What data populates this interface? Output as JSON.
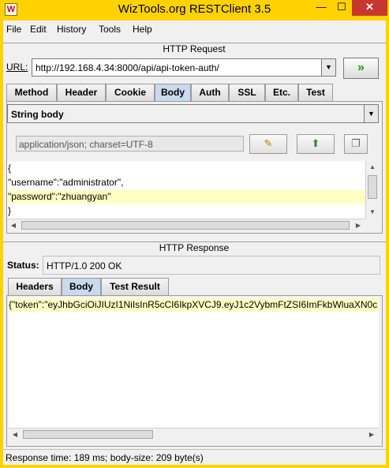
{
  "window": {
    "title": "WizTools.org RESTClient 3.5",
    "controls": {
      "minimize": "—",
      "maximize": "☐",
      "close": "✕"
    }
  },
  "menu": [
    {
      "label": "File",
      "mnemonic": "F"
    },
    {
      "label": "Edit",
      "mnemonic": "E"
    },
    {
      "label": "History",
      "mnemonic": "H"
    },
    {
      "label": "Tools",
      "mnemonic": "T"
    },
    {
      "label": "Help",
      "mnemonic": "H"
    }
  ],
  "request": {
    "section_title": "HTTP Request",
    "url_label": "URL:",
    "url_value": "http://192.168.4.34:8000/api/api-token-auth/",
    "go_label": "»",
    "tabs": [
      {
        "label": "Method",
        "active": false
      },
      {
        "label": "Header",
        "active": false
      },
      {
        "label": "Cookie",
        "active": false
      },
      {
        "label": "Body",
        "active": true
      },
      {
        "label": "Auth",
        "active": false
      },
      {
        "label": "SSL",
        "active": false
      },
      {
        "label": "Etc.",
        "active": false
      },
      {
        "label": "Test",
        "active": false
      }
    ],
    "body_type": "String body",
    "content_type": "application/json; charset=UTF-8",
    "body_lines": [
      "{",
      "\"username\":\"administrator\",",
      "\"password\":\"zhuangyan\"",
      "}"
    ],
    "highlighted_line": 2
  },
  "response": {
    "section_title": "HTTP Response",
    "status_label": "Status:",
    "status_value": "HTTP/1.0 200 OK",
    "tabs": [
      {
        "label": "Headers",
        "active": false
      },
      {
        "label": "Body",
        "active": true
      },
      {
        "label": "Test Result",
        "active": false
      }
    ],
    "body_text": "{\"token\":\"eyJhbGciOiJIUzI1NiIsInR5cCI6IkpXVCJ9.eyJ1c2VybmFtZSI6ImFkbWluaXN0c"
  },
  "footer": {
    "status_text": "Response time: 189 ms; body-size: 209 byte(s)"
  },
  "colors": {
    "frame": "#ffd200",
    "active_tab": "#c9d9ee",
    "highlight_line": "#ffffc4",
    "go_arrow": "#1a9a1a"
  }
}
